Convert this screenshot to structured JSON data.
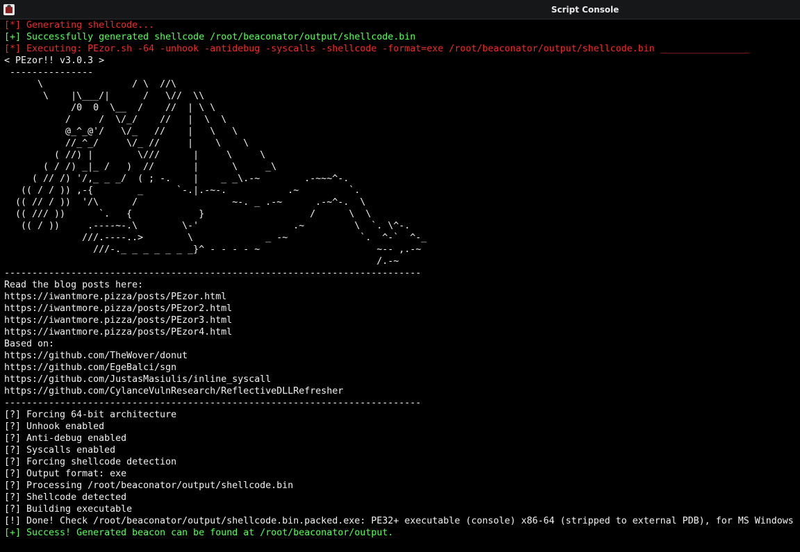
{
  "window": {
    "title": "Script Console",
    "app_icon": "script-console-app-icon"
  },
  "colors": {
    "background": "#000000",
    "error_red": "#ee2b2b",
    "success_green": "#55ff55",
    "text": "#f2f2f2"
  },
  "console": {
    "lines": [
      {
        "style": "red",
        "text": "[*] Generating shellcode..."
      },
      {
        "style": "green",
        "text": "[+] Successfully generated shellcode /root/beaconator/output/shellcode.bin"
      },
      {
        "style": "red",
        "text": "[*] Executing: PEzor.sh -64 -unhook -antidebug -syscalls -shellcode -format=exe /root/beaconator/output/shellcode.bin ________________"
      },
      {
        "style": "white",
        "text": "< PEzor!! v3.0.3 >"
      },
      {
        "style": "white",
        "text": " ---------------"
      },
      {
        "style": "white",
        "text": "      \\                / \\  //\\"
      },
      {
        "style": "white",
        "text": "       \\    |\\___/|      /   \\//  \\\\"
      },
      {
        "style": "white",
        "text": "            /0  0  \\__  /    //  | \\ \\"
      },
      {
        "style": "white",
        "text": "           /     /  \\/_/    //   |  \\  \\"
      },
      {
        "style": "white",
        "text": "           @_^_@'/   \\/_   //    |   \\   \\"
      },
      {
        "style": "white",
        "text": "           //_^_/     \\/_ //     |    \\    \\"
      },
      {
        "style": "white",
        "text": "         ( //) |        \\///      |     \\     \\"
      },
      {
        "style": "white",
        "text": "       ( / /) _|_ /   )  //       |      \\     _\\"
      },
      {
        "style": "white",
        "text": "     ( // /) '/,_ _ _/  ( ; -.    |    _ _\\.-~        .-~~~^-."
      },
      {
        "style": "white",
        "text": "   (( / / )) ,-{        _      `-.|.-~-.           .~         `."
      },
      {
        "style": "white",
        "text": "  (( // / ))  '/\\      /                 ~-. _ .-~      .-~^-.  \\"
      },
      {
        "style": "white",
        "text": "  (( /// ))      `.   {            }                   /      \\  \\"
      },
      {
        "style": "white",
        "text": "   (( / ))     .----~-.\\        \\-'                 .~         \\  `. \\^-."
      },
      {
        "style": "white",
        "text": "              ///.----..>        \\             _ -~             `.  ^-`  ^-_"
      },
      {
        "style": "white",
        "text": "                ///-._ _ _ _ _ _ _}^ - - - - ~                     ~-- ,.-~"
      },
      {
        "style": "white",
        "text": "                                                                   /.-~"
      },
      {
        "style": "white",
        "text": "---------------------------------------------------------------------------"
      },
      {
        "style": "white",
        "text": "Read the blog posts here:"
      },
      {
        "style": "white",
        "text": "https://iwantmore.pizza/posts/PEzor.html"
      },
      {
        "style": "white",
        "text": "https://iwantmore.pizza/posts/PEzor2.html"
      },
      {
        "style": "white",
        "text": "https://iwantmore.pizza/posts/PEzor3.html"
      },
      {
        "style": "white",
        "text": "https://iwantmore.pizza/posts/PEzor4.html"
      },
      {
        "style": "white",
        "text": "Based on:"
      },
      {
        "style": "white",
        "text": "https://github.com/TheWover/donut"
      },
      {
        "style": "white",
        "text": "https://github.com/EgeBalci/sgn"
      },
      {
        "style": "white",
        "text": "https://github.com/JustasMasiulis/inline_syscall"
      },
      {
        "style": "white",
        "text": "https://github.com/CylanceVulnResearch/ReflectiveDLLRefresher"
      },
      {
        "style": "white",
        "text": "---------------------------------------------------------------------------"
      },
      {
        "style": "white",
        "text": "[?] Forcing 64-bit architecture"
      },
      {
        "style": "white",
        "text": "[?] Unhook enabled"
      },
      {
        "style": "white",
        "text": "[?] Anti-debug enabled"
      },
      {
        "style": "white",
        "text": "[?] Syscalls enabled"
      },
      {
        "style": "white",
        "text": "[?] Forcing shellcode detection"
      },
      {
        "style": "white",
        "text": "[?] Output format: exe"
      },
      {
        "style": "white",
        "text": "[?] Processing /root/beaconator/output/shellcode.bin"
      },
      {
        "style": "white",
        "text": "[?] Shellcode detected"
      },
      {
        "style": "white",
        "text": "[?] Building executable"
      },
      {
        "style": "white",
        "text": "[!] Done! Check /root/beaconator/output/shellcode.bin.packed.exe: PE32+ executable (console) x86-64 (stripped to external PDB), for MS Windows"
      },
      {
        "style": "green",
        "text": "[+] Success! Generated beacon can be found at /root/beaconator/output."
      }
    ]
  }
}
